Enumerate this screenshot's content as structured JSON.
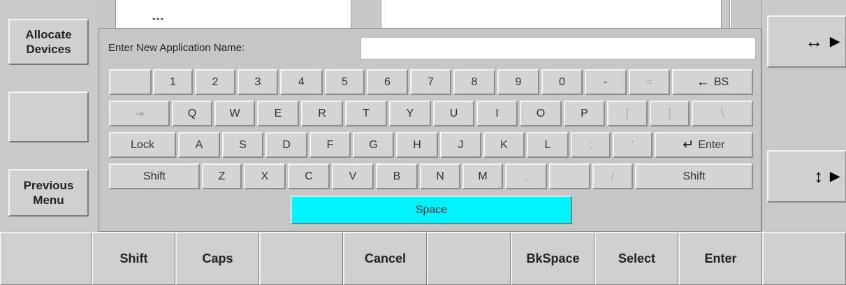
{
  "left_menu": {
    "allocate_devices": [
      "Allocate",
      "Devices"
    ],
    "previous_menu": [
      "Previous",
      "Menu"
    ]
  },
  "top_strip": {
    "dashes": "---"
  },
  "right_menu": {
    "horizontal_arrow": "↔",
    "vertical_arrow": "↕",
    "submenu_indicator": "▶"
  },
  "keyboard": {
    "prompt_label": "Enter New Application Name:",
    "name_value": "",
    "rows": [
      [
        "`",
        "1",
        "2",
        "3",
        "4",
        "5",
        "6",
        "7",
        "8",
        "9",
        "0",
        "-",
        "=",
        "BS"
      ],
      [
        "⇥",
        "Q",
        "W",
        "E",
        "R",
        "T",
        "Y",
        "U",
        "I",
        "O",
        "P",
        "[",
        "]",
        "\\"
      ],
      [
        "Lock",
        "A",
        "S",
        "D",
        "F",
        "G",
        "H",
        "J",
        "K",
        "L",
        ";",
        "'",
        "Enter"
      ],
      [
        "Shift",
        "Z",
        "X",
        "C",
        "V",
        "B",
        "N",
        "M",
        ",",
        ".",
        "/",
        "Shift"
      ]
    ],
    "space_label": "Space",
    "backspace_glyph": "←",
    "enter_glyph": "↵"
  },
  "softkeys": [
    "",
    "Shift",
    "Caps",
    "",
    "Cancel",
    "",
    "BkSpace",
    "Select",
    "Enter",
    ""
  ]
}
